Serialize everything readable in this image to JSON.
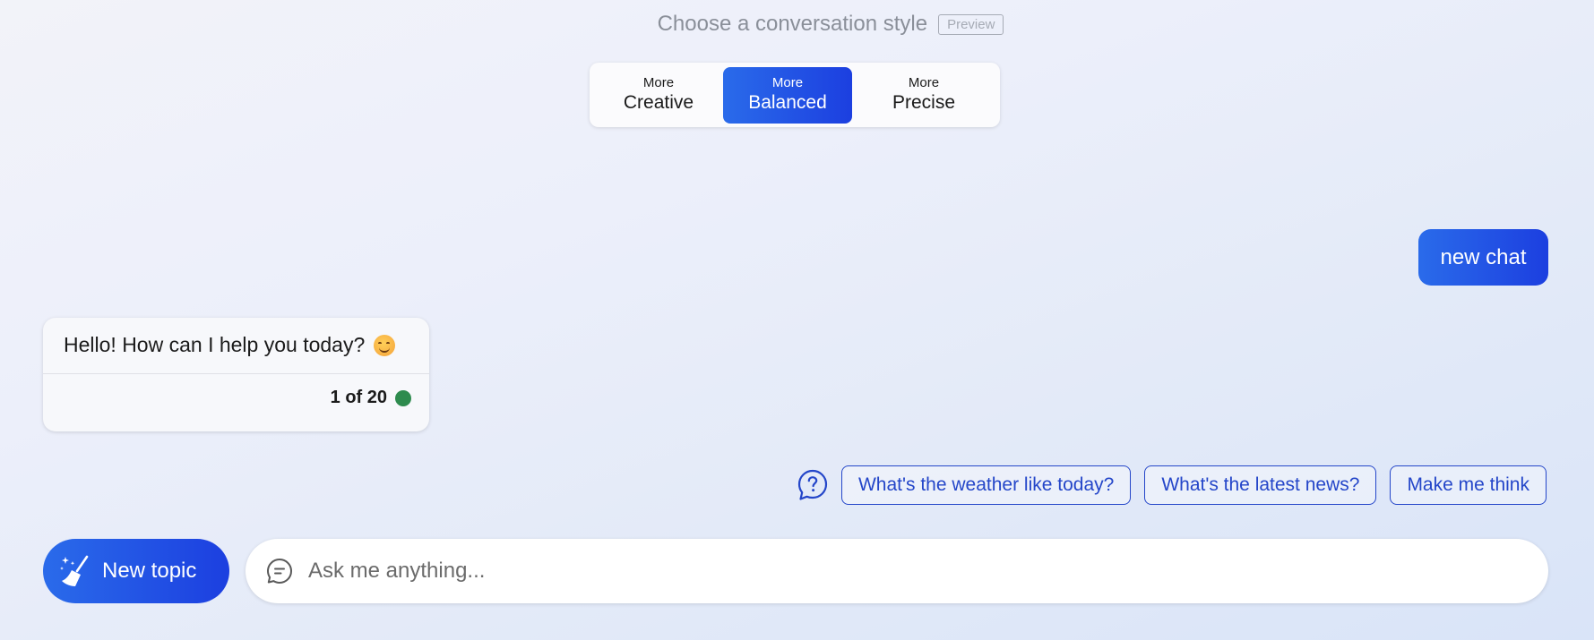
{
  "header": {
    "title": "Choose a conversation style",
    "badge": "Preview"
  },
  "styles": [
    {
      "prefix": "More",
      "label": "Creative",
      "active": false
    },
    {
      "prefix": "More",
      "label": "Balanced",
      "active": true
    },
    {
      "prefix": "More",
      "label": "Precise",
      "active": false
    }
  ],
  "user_message": "new chat",
  "bot_message": {
    "text": "Hello! How can I help you today?",
    "emoji": "smiling-face-icon",
    "counter": "1 of 20",
    "status_color": "#2e8b4e"
  },
  "suggestions": {
    "icon": "question-bubble-icon",
    "items": [
      "What's the weather like today?",
      "What's the latest news?",
      "Make me think"
    ]
  },
  "new_topic": {
    "label": "New topic",
    "icon": "broom-sparkle-icon"
  },
  "input": {
    "placeholder": "Ask me anything...",
    "value": "",
    "icon": "chat-bubble-icon"
  },
  "colors": {
    "accent_start": "#2a6bea",
    "accent_end": "#1c3fe0",
    "chip": "#2446c9"
  }
}
